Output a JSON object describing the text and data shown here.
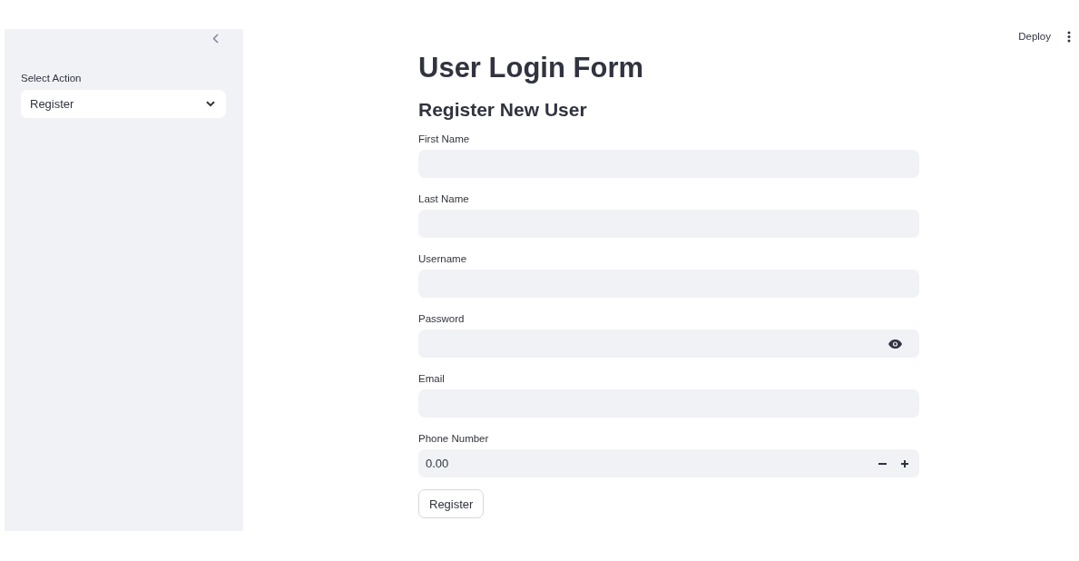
{
  "sidebar": {
    "select": {
      "label": "Select Action",
      "value": "Register"
    }
  },
  "header": {
    "deploy": "Deploy"
  },
  "title": "User Login Form",
  "subtitle": "Register New User",
  "fields": [
    {
      "kind": "text",
      "label": "First Name"
    },
    {
      "kind": "text",
      "label": "Last Name"
    },
    {
      "kind": "text",
      "label": "Username"
    },
    {
      "kind": "password",
      "label": "Password"
    },
    {
      "kind": "text",
      "label": "Email"
    },
    {
      "kind": "number",
      "label": "Phone Number",
      "value": "0.00"
    }
  ],
  "submit": "Register"
}
